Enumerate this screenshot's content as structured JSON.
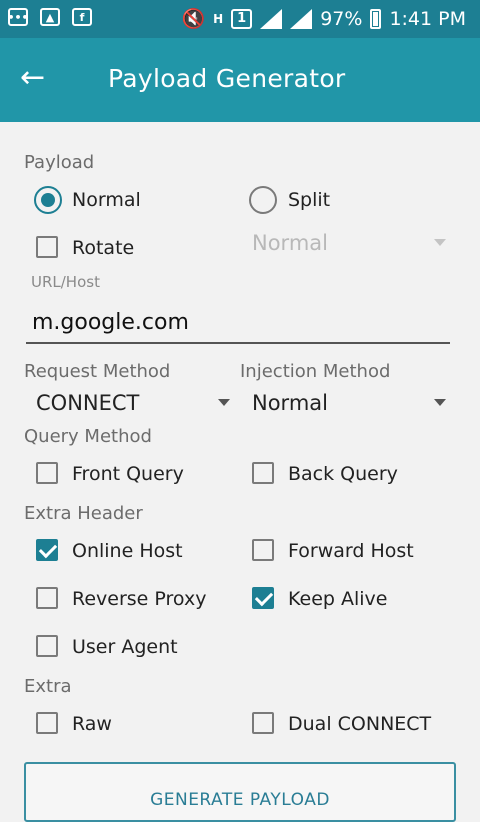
{
  "statusbar": {
    "battery": "97%",
    "time": "1:41 PM",
    "sim": "1",
    "network": "H"
  },
  "appbar": {
    "title": "Payload Generator"
  },
  "payload": {
    "section_label": "Payload",
    "normal_label": "Normal",
    "split_label": "Split",
    "rotate_label": "Rotate",
    "rotate_dropdown_value": "Normal"
  },
  "url_host": {
    "label": "URL/Host",
    "value": "m.google.com"
  },
  "request_method": {
    "label": "Request Method",
    "value": "CONNECT"
  },
  "injection_method": {
    "label": "Injection Method",
    "value": "Normal"
  },
  "query_method": {
    "label": "Query Method",
    "front": "Front Query",
    "back": "Back Query"
  },
  "extra_header": {
    "label": "Extra Header",
    "online_host": "Online Host",
    "forward_host": "Forward Host",
    "reverse_proxy": "Reverse Proxy",
    "keep_alive": "Keep Alive",
    "user_agent": "User Agent"
  },
  "extra": {
    "label": "Extra",
    "raw": "Raw",
    "dual_connect": "Dual CONNECT"
  },
  "generate_button": "GENERATE PAYLOAD"
}
